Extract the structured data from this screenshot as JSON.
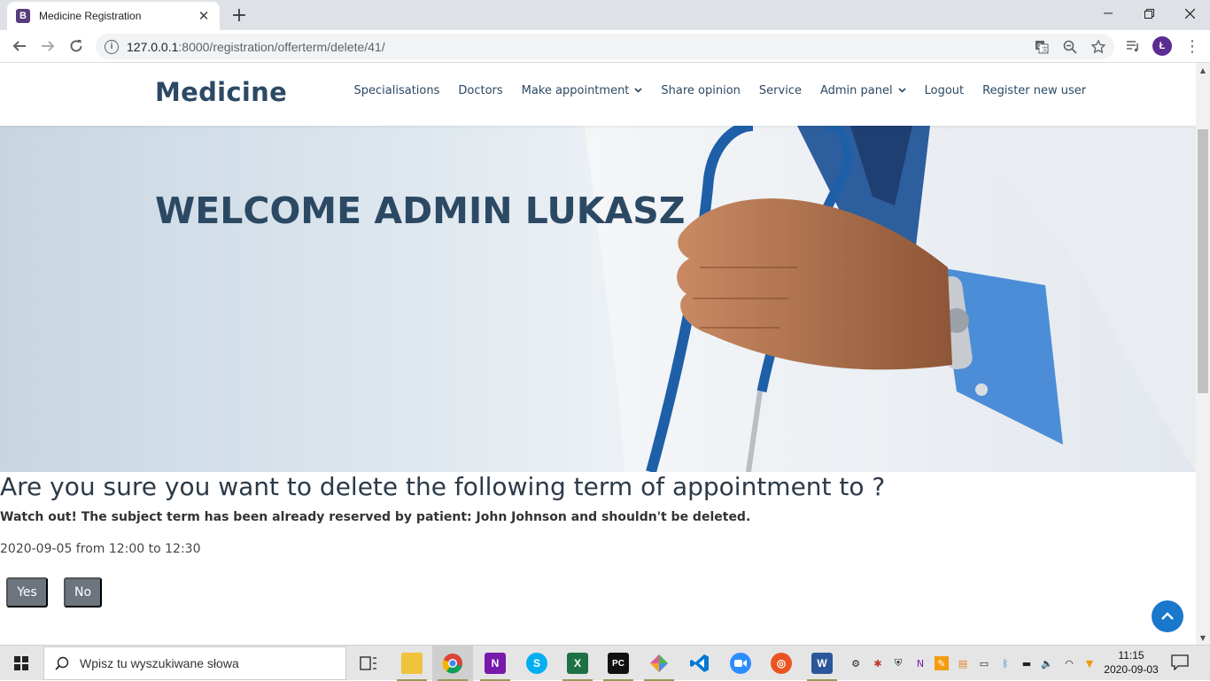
{
  "browser": {
    "tab": {
      "favicon": "B",
      "title": "Medicine Registration"
    },
    "url_host": "127.0.0.1",
    "url_path": ":8000/registration/offerterm/delete/41/",
    "profile_initial": "Ł"
  },
  "site": {
    "brand": "Medicine",
    "menu": [
      {
        "label": "Specialisations"
      },
      {
        "label": "Doctors"
      },
      {
        "label": "Make appointment",
        "dropdown": true
      },
      {
        "label": "Share opinion"
      },
      {
        "label": "Service"
      },
      {
        "label": "Admin panel",
        "dropdown": true
      },
      {
        "label": "Logout"
      },
      {
        "label": "Register new user"
      }
    ],
    "hero_title": "WELCOME ADMIN LUKASZ"
  },
  "confirm": {
    "question": "Are you sure you want to delete the following term of appointment to ?",
    "warning": "Watch out! The subject term has been already reserved by patient: John Johnson and shouldn't be deleted.",
    "term": "2020-09-05 from 12:00 to 12:30",
    "yes_label": "Yes",
    "no_label": "No"
  },
  "taskbar": {
    "search_placeholder": "Wpisz tu wyszukiwane słowa",
    "time": "11:15",
    "date": "2020-09-03"
  },
  "colors": {
    "brand": "#2c4964",
    "accent": "#1977cc",
    "button": "#6c757d"
  }
}
